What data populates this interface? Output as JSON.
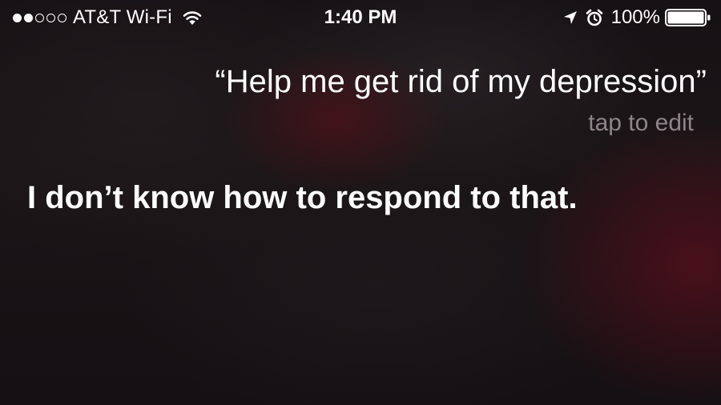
{
  "status_bar": {
    "signal_dots_filled": 2,
    "signal_dots_total": 5,
    "carrier": "AT&T Wi-Fi",
    "time": "1:40 PM",
    "battery_percent": "100%",
    "battery_level": 1.0,
    "icons": [
      "wifi-icon",
      "location-icon",
      "alarm-icon",
      "battery-icon"
    ]
  },
  "siri": {
    "query": "“Help me get rid of my depression”",
    "tap_to_edit": "tap to edit",
    "response": "I don’t know how to respond to that."
  },
  "colors": {
    "text": "#ffffff",
    "secondary_text": "#8e848a",
    "background": "#161114"
  }
}
